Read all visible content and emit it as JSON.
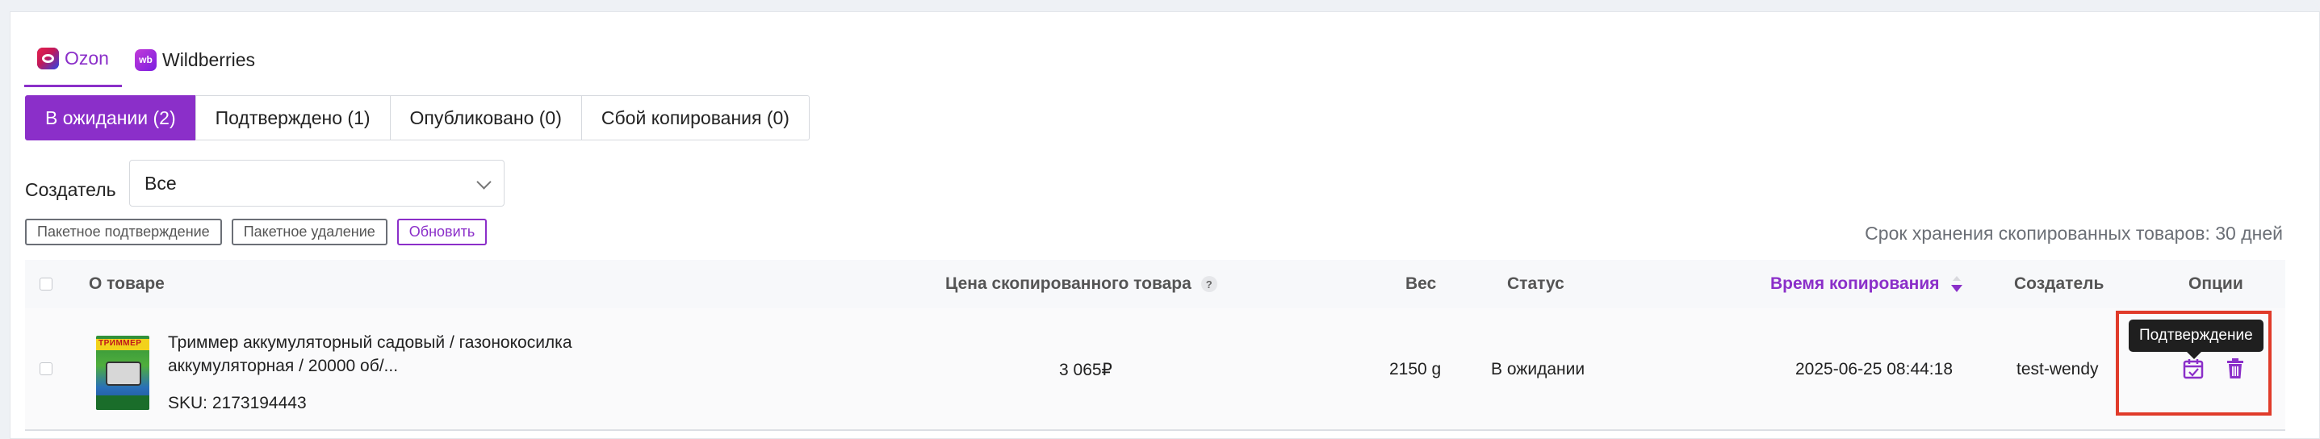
{
  "platform_tabs": [
    {
      "label": "Ozon",
      "icon": "ozon-logo",
      "active": true
    },
    {
      "label": "Wildberries",
      "icon": "wildberries-logo",
      "logo_text": "wb",
      "active": false
    }
  ],
  "status_tabs": [
    {
      "label": "В ожидании (2)",
      "active": true
    },
    {
      "label": "Подтверждено (1)",
      "active": false
    },
    {
      "label": "Опубликовано (0)",
      "active": false
    },
    {
      "label": "Сбой копирования (0)",
      "active": false
    }
  ],
  "filter": {
    "creator_label": "Создатель",
    "creator_value": "Все"
  },
  "actions": {
    "batch_confirm": "Пакетное подтверждение",
    "batch_delete": "Пакетное удаление",
    "refresh": "Обновить"
  },
  "retention_text": "Срок хранения скопированных товаров: 30 дней",
  "table": {
    "headers": {
      "product": "О товаре",
      "price": "Цена скопированного товара",
      "price_help": "?",
      "weight": "Вес",
      "status": "Статус",
      "copy_time": "Время копирования",
      "creator": "Создатель",
      "options": "Опции"
    },
    "sort": {
      "column": "copy_time",
      "direction": "desc"
    },
    "rows": [
      {
        "image_label": "ТРИММЕР",
        "name": "Триммер аккумуляторный садовый / газонокосилка аккумуляторная / 20000 об/...",
        "sku": "SKU: 2173194443",
        "price": "3 065₽",
        "weight": "2150 g",
        "status": "В ожидании",
        "copy_time": "2025-06-25 08:44:18",
        "creator": "test-wendy"
      }
    ]
  },
  "tooltip": "Подтверждение",
  "colors": {
    "accent": "#8b2fc9",
    "highlight": "#e03b2a"
  }
}
